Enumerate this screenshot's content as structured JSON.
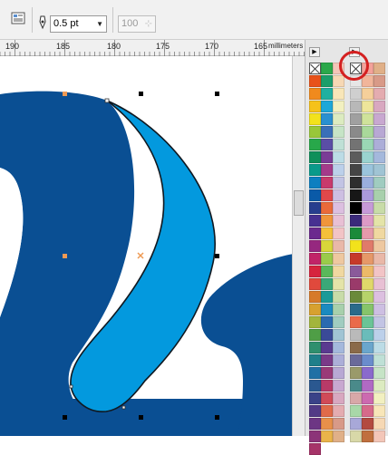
{
  "toolbar": {
    "outline_width": "0.5 pt",
    "numeric_value": "100",
    "icons": [
      "object-properties-icon",
      "outline-pen-icon",
      "dropdown-arrow-icon",
      "spinner-icon"
    ]
  },
  "ruler": {
    "ticks": [
      "190",
      "185",
      "180",
      "175",
      "170",
      "165"
    ],
    "unit": "millimeters"
  },
  "canvas": {
    "colors": {
      "dark_shape": "#0a4f93",
      "light_shape": "#0399de",
      "outline": "#101820",
      "node_orange": "#ef9a54"
    }
  },
  "palette": {
    "selected_swatch": "no-color"
  }
}
